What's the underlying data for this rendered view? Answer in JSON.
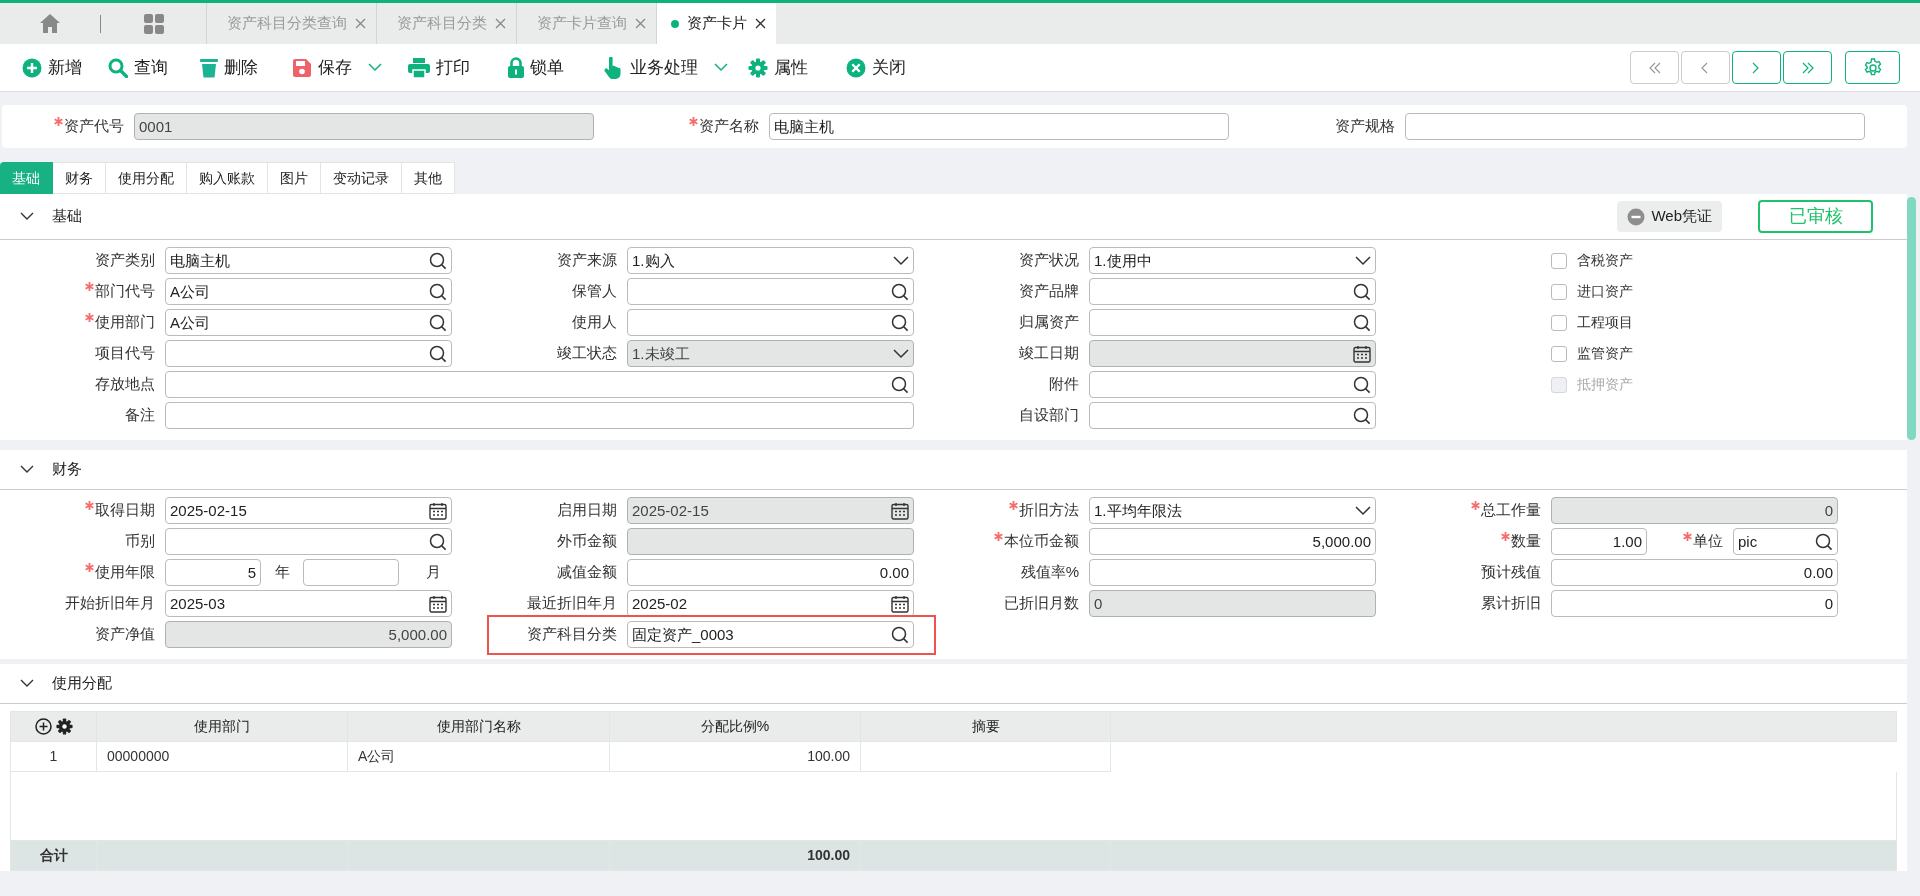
{
  "top_tabs": [
    {
      "label": "资产科目分类查询",
      "selected": false
    },
    {
      "label": "资产科目分类",
      "selected": false
    },
    {
      "label": "资产卡片查询",
      "selected": false
    },
    {
      "label": "资产卡片",
      "selected": true
    }
  ],
  "toolbar": [
    {
      "kind": "add",
      "label": "新增",
      "dropdown": false
    },
    {
      "kind": "query",
      "label": "查询",
      "dropdown": false
    },
    {
      "kind": "delete",
      "label": "删除",
      "dropdown": false
    },
    {
      "kind": "save",
      "label": "保存",
      "dropdown": true
    },
    {
      "kind": "print",
      "label": "打印",
      "dropdown": false
    },
    {
      "kind": "lock",
      "label": "锁单",
      "dropdown": false
    },
    {
      "kind": "process",
      "label": "业务处理",
      "dropdown": true
    },
    {
      "kind": "props",
      "label": "属性",
      "dropdown": false
    },
    {
      "kind": "close",
      "label": "关闭",
      "dropdown": false
    }
  ],
  "pager": [
    {
      "kind": "first",
      "disabled": true
    },
    {
      "kind": "prev",
      "disabled": true
    },
    {
      "kind": "next",
      "disabled": false
    },
    {
      "kind": "last",
      "disabled": false
    }
  ],
  "header_fields": [
    {
      "label": "资产代号",
      "required": true,
      "value": "0001",
      "disabled": true
    },
    {
      "label": "资产名称",
      "required": true,
      "value": "电脑主机",
      "disabled": false
    },
    {
      "label": "资产规格",
      "required": false,
      "disabled": false
    }
  ],
  "form_tabs": [
    {
      "label": "基础",
      "selected": true
    },
    {
      "label": "财务",
      "selected": false
    },
    {
      "label": "使用分配",
      "selected": false
    },
    {
      "label": "购入账款",
      "selected": false
    },
    {
      "label": "图片",
      "selected": false
    },
    {
      "label": "变动记录",
      "selected": false
    },
    {
      "label": "其他",
      "selected": false
    }
  ],
  "basic_section": {
    "title": "基础",
    "expanded": true,
    "voucher_button": "Web凭证",
    "status_stamp": "已审核",
    "rows": [
      [
        {
          "label": "资产类别",
          "required": false,
          "kind": "search",
          "value": "电脑主机",
          "disabled": false
        },
        {
          "label": "资产来源",
          "required": false,
          "kind": "select",
          "value": "1.购入",
          "disabled": false
        },
        {
          "label": "资产状况",
          "required": false,
          "kind": "select",
          "value": "1.使用中",
          "disabled": false
        }
      ],
      [
        {
          "label": "部门代号",
          "required": true,
          "kind": "search",
          "value": "A公司",
          "disabled": false
        },
        {
          "label": "保管人",
          "required": false,
          "kind": "search",
          "disabled": false
        },
        {
          "label": "资产品牌",
          "required": false,
          "kind": "search",
          "disabled": false
        }
      ],
      [
        {
          "label": "使用部门",
          "required": true,
          "kind": "search",
          "value": "A公司",
          "disabled": false
        },
        {
          "label": "使用人",
          "required": false,
          "kind": "search",
          "disabled": false
        },
        {
          "label": "归属资产",
          "required": false,
          "kind": "search",
          "disabled": false
        }
      ],
      [
        {
          "label": "项目代号",
          "required": false,
          "kind": "search",
          "disabled": false
        },
        {
          "label": "竣工状态",
          "required": false,
          "kind": "select",
          "value": "1.未竣工",
          "disabled": true
        },
        {
          "label": "竣工日期",
          "required": false,
          "kind": "date",
          "disabled": true
        }
      ],
      [
        {
          "label": "存放地点",
          "required": false,
          "kind": "search",
          "disabled": false,
          "colspan": 2
        },
        {
          "label": "附件",
          "required": false,
          "kind": "search",
          "disabled": false
        }
      ],
      [
        {
          "label": "备注",
          "required": false,
          "kind": "text",
          "disabled": false,
          "colspan": 2
        },
        {
          "label": "自设部门",
          "required": false,
          "kind": "search",
          "disabled": false
        }
      ]
    ],
    "flags": [
      {
        "label": "含税资产",
        "checked": false,
        "disabled": false
      },
      {
        "label": "进口资产",
        "checked": false,
        "disabled": false
      },
      {
        "label": "工程项目",
        "checked": false,
        "disabled": false
      },
      {
        "label": "监管资产",
        "checked": false,
        "disabled": false
      },
      {
        "label": "抵押资产",
        "checked": false,
        "disabled": true
      }
    ]
  },
  "finance_section": {
    "title": "财务",
    "expanded": true,
    "rows": [
      [
        {
          "label": "取得日期",
          "required": true,
          "kind": "date",
          "value": "2025-02-15",
          "disabled": false
        },
        {
          "label": "启用日期",
          "required": false,
          "kind": "date",
          "value": "2025-02-15",
          "disabled": true
        },
        {
          "label": "折旧方法",
          "required": true,
          "kind": "select",
          "value": "1.平均年限法",
          "disabled": false
        },
        {
          "label": "总工作量",
          "required": true,
          "kind": "number",
          "value": "0",
          "disabled": true
        }
      ],
      [
        {
          "label": "币别",
          "required": false,
          "kind": "search",
          "disabled": false
        },
        {
          "label": "外币金额",
          "required": false,
          "kind": "text",
          "disabled": true
        },
        {
          "label": "本位币金额",
          "required": true,
          "kind": "number",
          "value": "5,000.00",
          "disabled": false
        },
        {
          "kind": "qty_unit",
          "label": "数量",
          "required": true,
          "value": "1.00",
          "disabled": false,
          "unit_label": "单位",
          "unit_required": true,
          "unit_value": "pic"
        }
      ],
      [
        {
          "kind": "period",
          "label": "使用年限",
          "required": true,
          "years": "5",
          "year_unit": "年",
          "month_unit": "月",
          "disabled": false
        },
        {
          "label": "减值金额",
          "required": false,
          "kind": "number",
          "value": "0.00",
          "disabled": false
        },
        {
          "label": "残值率%",
          "required": false,
          "kind": "text",
          "disabled": false
        },
        {
          "label": "预计残值",
          "required": false,
          "kind": "number",
          "value": "0.00",
          "disabled": false
        }
      ],
      [
        {
          "label": "开始折旧年月",
          "required": false,
          "kind": "date",
          "value": "2025-03",
          "disabled": false
        },
        {
          "label": "最近折旧年月",
          "required": false,
          "kind": "date",
          "value": "2025-02",
          "disabled": false
        },
        {
          "label": "已折旧月数",
          "required": false,
          "kind": "text",
          "value": "0",
          "disabled": true
        },
        {
          "label": "累计折旧",
          "required": false,
          "kind": "number",
          "value": "0",
          "disabled": false
        }
      ],
      [
        {
          "label": "资产净值",
          "required": false,
          "kind": "number",
          "value": "5,000.00",
          "disabled": true
        },
        {
          "label": "资产科目分类",
          "required": false,
          "kind": "search",
          "value": "固定资产_0003",
          "disabled": false,
          "highlighted": true
        }
      ]
    ]
  },
  "allocation_section": {
    "title": "使用分配",
    "expanded": true,
    "table": {
      "columns": [
        {
          "label": "使用部门",
          "kind": "text"
        },
        {
          "label": "使用部门名称",
          "kind": "text"
        },
        {
          "label": "分配比例%",
          "kind": "number"
        },
        {
          "label": "摘要",
          "kind": "text"
        }
      ],
      "rows": [
        {
          "no": "1",
          "cells": [
            "00000000",
            "A公司",
            "100.00"
          ]
        }
      ],
      "total": {
        "label": "合计",
        "sum": "100.00"
      }
    }
  }
}
